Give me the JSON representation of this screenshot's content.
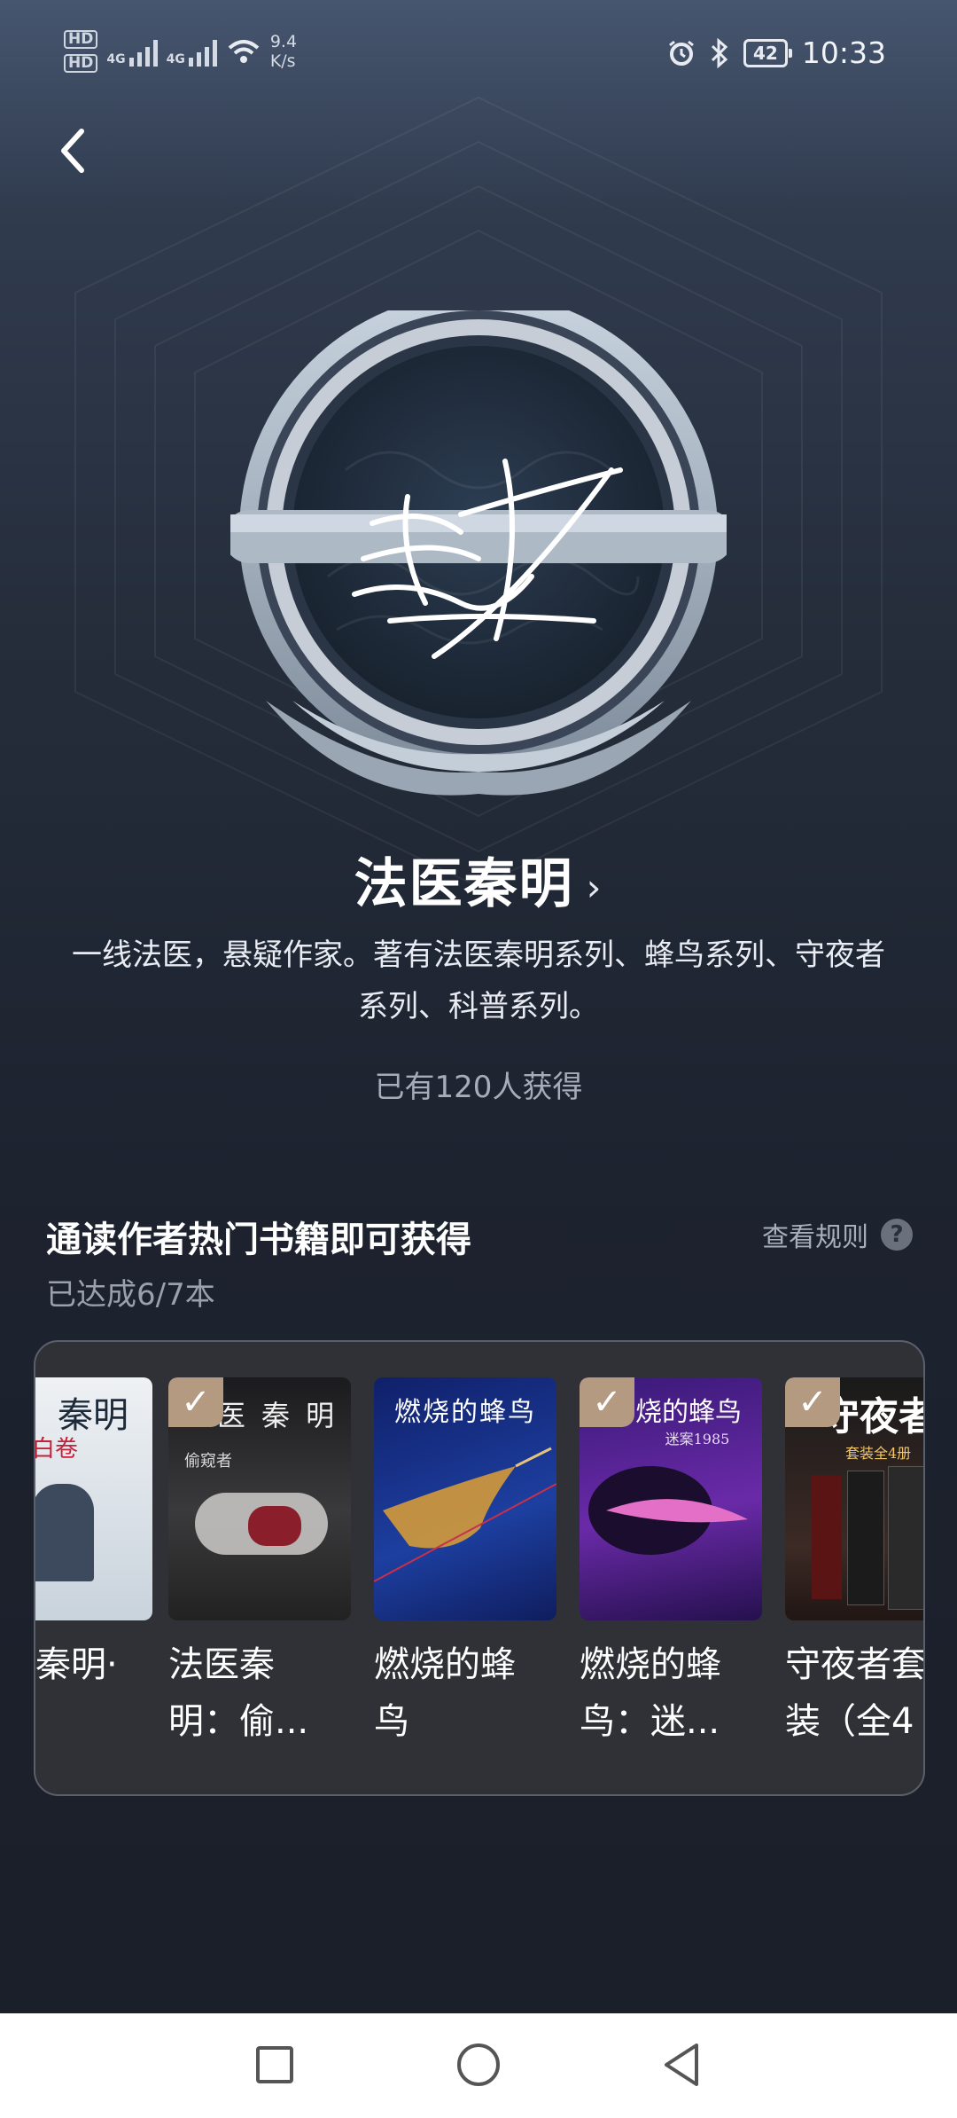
{
  "status_bar": {
    "hd1": "HD",
    "hd2": "HD",
    "net1": "4G",
    "net2": "4G",
    "speed_value": "9.4",
    "speed_unit": "K/s",
    "battery": "42",
    "time": "10:33"
  },
  "badge": {
    "author_name": "法医秦明",
    "description": "一线法医，悬疑作家。著有法医秦明系列、蜂鸟系列、守夜者系列、科普系列。",
    "owned_count_text": "已有120人获得"
  },
  "task": {
    "title": "通读作者热门书籍即可获得",
    "rules_label": "查看规则",
    "rules_icon": "?",
    "progress_text": "已达成6/7本"
  },
  "books": [
    {
      "title_line1": "秦明·",
      "title_line2": "",
      "cover_text": "秦明",
      "cover_sub": "白卷",
      "checked": false
    },
    {
      "title_line1": "法医秦",
      "title_line2": "明：偷...",
      "cover_text": "医 秦 明",
      "cover_sub": "偷窥者",
      "checked": true
    },
    {
      "title_line1": "燃烧的蜂",
      "title_line2": "鸟",
      "cover_text": "燃烧的蜂鸟",
      "cover_sub": "",
      "checked": false
    },
    {
      "title_line1": "燃烧的蜂",
      "title_line2": "鸟：迷...",
      "cover_text": "烧的蜂鸟",
      "cover_sub": "迷案1985",
      "checked": true
    },
    {
      "title_line1": "守夜者套",
      "title_line2": "装（全4",
      "cover_text": "守夜者",
      "cover_sub": "套装全4册",
      "checked": true
    }
  ],
  "colors": {
    "check_badge": "#b39a80",
    "panel_bg": "#2f3137",
    "page_bg": "#1d232f"
  },
  "icons": {
    "back": "back-arrow-icon",
    "alarm": "alarm-icon",
    "bluetooth": "bluetooth-icon",
    "wifi": "wifi-icon",
    "check": "check-icon",
    "recent": "recent-apps-icon",
    "home": "home-icon",
    "navback": "nav-back-icon"
  }
}
